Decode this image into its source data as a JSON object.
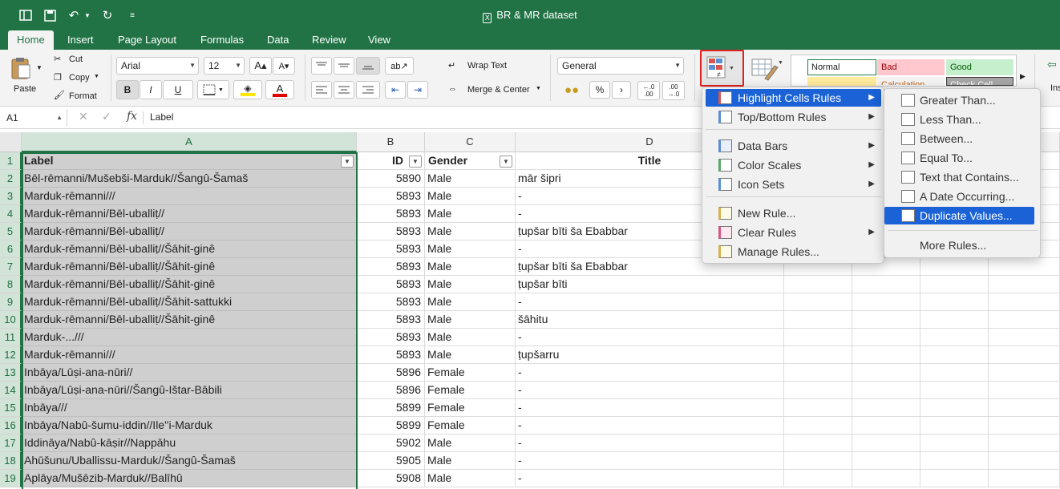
{
  "window": {
    "title": "BR & MR dataset",
    "qa_icons": [
      "sidebar-icon",
      "save-icon",
      "undo-icon",
      "redo-icon",
      "customize-icon"
    ]
  },
  "tabs": [
    "Home",
    "Insert",
    "Page Layout",
    "Formulas",
    "Data",
    "Review",
    "View"
  ],
  "ribbon": {
    "paste": "Paste",
    "cut": "Cut",
    "copy": "Copy",
    "format": "Format",
    "font_name": "Arial",
    "font_size": "12",
    "bold": "B",
    "italic": "I",
    "underline": "U",
    "font_color_letter": "A",
    "wrap_text": "Wrap Text",
    "merge_center": "Merge & Center",
    "number_format": "General",
    "percent": "%",
    "comma": "›",
    "inc_decimal": "←.0 .00",
    "dec_decimal": ".00 →.0",
    "styles": {
      "normal": "Normal",
      "bad": "Bad",
      "good": "Good",
      "cut_ins": "Calculation",
      "cut_check": "Check Cell"
    },
    "insert_partial": "Ins",
    "accent_colors": {
      "green": "#217346",
      "bad_bg": "#ffc7ce",
      "bad_fg": "#9c0006",
      "good_bg": "#c6efce",
      "good_fg": "#006100",
      "highlight": "#1a62d6"
    }
  },
  "formula_bar": {
    "cell_ref": "A1",
    "fx": "fx",
    "content": "Label"
  },
  "columns": [
    "A",
    "B",
    "C",
    "D"
  ],
  "headers": {
    "label": "Label",
    "id": "ID",
    "gender": "Gender",
    "title": "Title"
  },
  "rows": [
    {
      "n": "1"
    },
    {
      "n": "2",
      "label": "Bēl-rēmanni/Mušebši-Marduk//Šangû-Šamaš",
      "id": "5890",
      "gender": "Male",
      "title": "mār šipri"
    },
    {
      "n": "3",
      "label": "Marduk-rēmanni///",
      "id": "5893",
      "gender": "Male",
      "title": "-"
    },
    {
      "n": "4",
      "label": "Marduk-rēmanni/Bēl-uballiṭ//",
      "id": "5893",
      "gender": "Male",
      "title": "-"
    },
    {
      "n": "5",
      "label": "Marduk-rēmanni/Bēl-uballiṭ//",
      "id": "5893",
      "gender": "Male",
      "title": "ṭupšar bīti ša Ebabbar"
    },
    {
      "n": "6",
      "label": "Marduk-rēmanni/Bēl-uballiṭ//Šāhit-ginê",
      "id": "5893",
      "gender": "Male",
      "title": "-"
    },
    {
      "n": "7",
      "label": "Marduk-rēmanni/Bēl-uballiṭ//Šāhit-ginê",
      "id": "5893",
      "gender": "Male",
      "title": "ṭupšar bīti ša Ebabbar"
    },
    {
      "n": "8",
      "label": "Marduk-rēmanni/Bēl-uballiṭ//Šāhit-ginê",
      "id": "5893",
      "gender": "Male",
      "title": "ṭupšar bīti"
    },
    {
      "n": "9",
      "label": "Marduk-rēmanni/Bēl-uballiṭ//Šāhit-sattukki",
      "id": "5893",
      "gender": "Male",
      "title": "-"
    },
    {
      "n": "10",
      "label": "Marduk-rēmanni/Bēl-uballiṭ//Šāhit-ginê",
      "id": "5893",
      "gender": "Male",
      "title": "šāhitu"
    },
    {
      "n": "11",
      "label": "Marduk-...///",
      "id": "5893",
      "gender": "Male",
      "title": "-"
    },
    {
      "n": "12",
      "label": "Marduk-rēmanni///",
      "id": "5893",
      "gender": "Male",
      "title": "ṭupšarru"
    },
    {
      "n": "13",
      "label": "Inbāya/Lūṣi-ana-nūri//",
      "id": "5896",
      "gender": "Female",
      "title": "-"
    },
    {
      "n": "14",
      "label": "Inbāya/Lūṣi-ana-nūri//Šangû-Ištar-Bābili",
      "id": "5896",
      "gender": "Female",
      "title": "-"
    },
    {
      "n": "15",
      "label": "Inbāya///",
      "id": "5899",
      "gender": "Female",
      "title": "-"
    },
    {
      "n": "16",
      "label": "Inbāya/Nabû-šumu-iddin//Ile''i-Marduk",
      "id": "5899",
      "gender": "Female",
      "title": "-"
    },
    {
      "n": "17",
      "label": "Iddināya/Nabû-kāṣir//Nappāhu",
      "id": "5902",
      "gender": "Male",
      "title": "-"
    },
    {
      "n": "18",
      "label": "Ahūšunu/Uballissu-Marduk//Šangû-Šamaš",
      "id": "5905",
      "gender": "Male",
      "title": "-"
    },
    {
      "n": "19",
      "label": "Aplāya/Mušēzib-Marduk//Balīhû",
      "id": "5908",
      "gender": "Male",
      "title": "-"
    }
  ],
  "cf_menu": {
    "items": [
      {
        "label": "Highlight Cells Rules",
        "sub": true,
        "icon": "highlight-cells-icon"
      },
      {
        "label": "Top/Bottom Rules",
        "sub": true,
        "icon": "top-bottom-icon"
      },
      {
        "label": "Data Bars",
        "sub": true,
        "icon": "data-bars-icon"
      },
      {
        "label": "Color Scales",
        "sub": true,
        "icon": "color-scales-icon"
      },
      {
        "label": "Icon Sets",
        "sub": true,
        "icon": "icon-sets-icon"
      },
      {
        "label": "New Rule...",
        "sub": false,
        "icon": "new-rule-icon"
      },
      {
        "label": "Clear Rules",
        "sub": true,
        "icon": "clear-rules-icon"
      },
      {
        "label": "Manage Rules...",
        "sub": false,
        "icon": "manage-rules-icon"
      }
    ]
  },
  "hc_submenu": {
    "items": [
      {
        "label": "Greater Than...",
        "icon": "greater-than-icon"
      },
      {
        "label": "Less Than...",
        "icon": "less-than-icon"
      },
      {
        "label": "Between...",
        "icon": "between-icon"
      },
      {
        "label": "Equal To...",
        "icon": "equal-to-icon"
      },
      {
        "label": "Text that Contains...",
        "icon": "text-contains-icon"
      },
      {
        "label": "A Date Occurring...",
        "icon": "date-occurring-icon"
      },
      {
        "label": "Duplicate Values...",
        "icon": "duplicate-values-icon"
      }
    ],
    "more": "More Rules..."
  }
}
